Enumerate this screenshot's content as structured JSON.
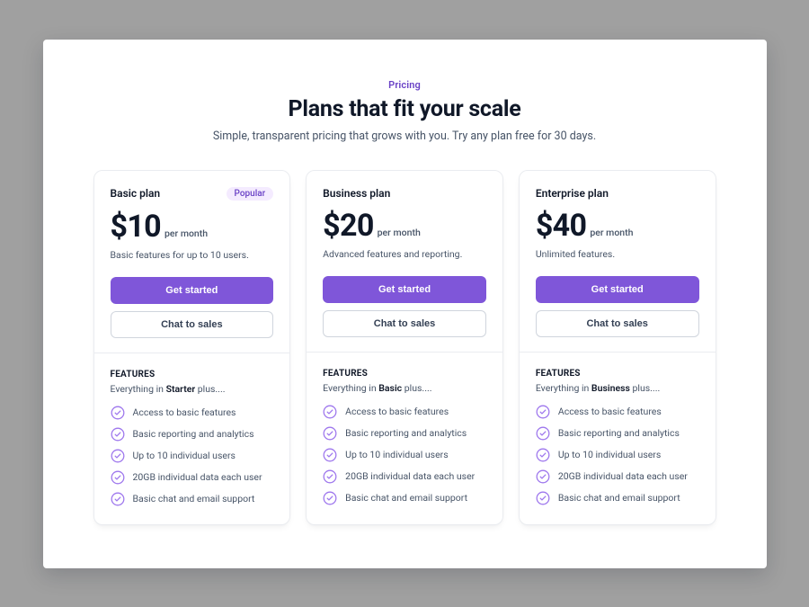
{
  "header": {
    "eyebrow": "Pricing",
    "title": "Plans that fit your scale",
    "subtitle": "Simple, transparent pricing that grows with you. Try any plan free for 30 days."
  },
  "common": {
    "per_month": "per month",
    "features_title": "FEATURES",
    "get_started": "Get started",
    "chat_to_sales": "Chat to sales"
  },
  "plans": [
    {
      "name": "Basic plan",
      "badge": "Popular",
      "price": "$10",
      "desc": "Basic features for up to 10 users.",
      "features_lead_prefix": "Everything in ",
      "features_lead_strong": "Starter",
      "features_lead_suffix": " plus....",
      "features": [
        "Access to basic features",
        "Basic reporting and analytics",
        "Up to 10 individual users",
        "20GB individual data each user",
        "Basic chat and email support"
      ]
    },
    {
      "name": "Business plan",
      "badge": null,
      "price": "$20",
      "desc": "Advanced features and reporting.",
      "features_lead_prefix": "Everything in ",
      "features_lead_strong": "Basic",
      "features_lead_suffix": " plus....",
      "features": [
        "Access to basic features",
        "Basic reporting and analytics",
        "Up to 10 individual users",
        "20GB individual data each user",
        "Basic chat and email support"
      ]
    },
    {
      "name": "Enterprise plan",
      "badge": null,
      "price": "$40",
      "desc": "Unlimited features.",
      "features_lead_prefix": "Everything in ",
      "features_lead_strong": "Business",
      "features_lead_suffix": " plus....",
      "features": [
        "Access to basic features",
        "Basic reporting and analytics",
        "Up to 10 individual users",
        "20GB individual data each user",
        "Basic chat and email support"
      ]
    }
  ]
}
